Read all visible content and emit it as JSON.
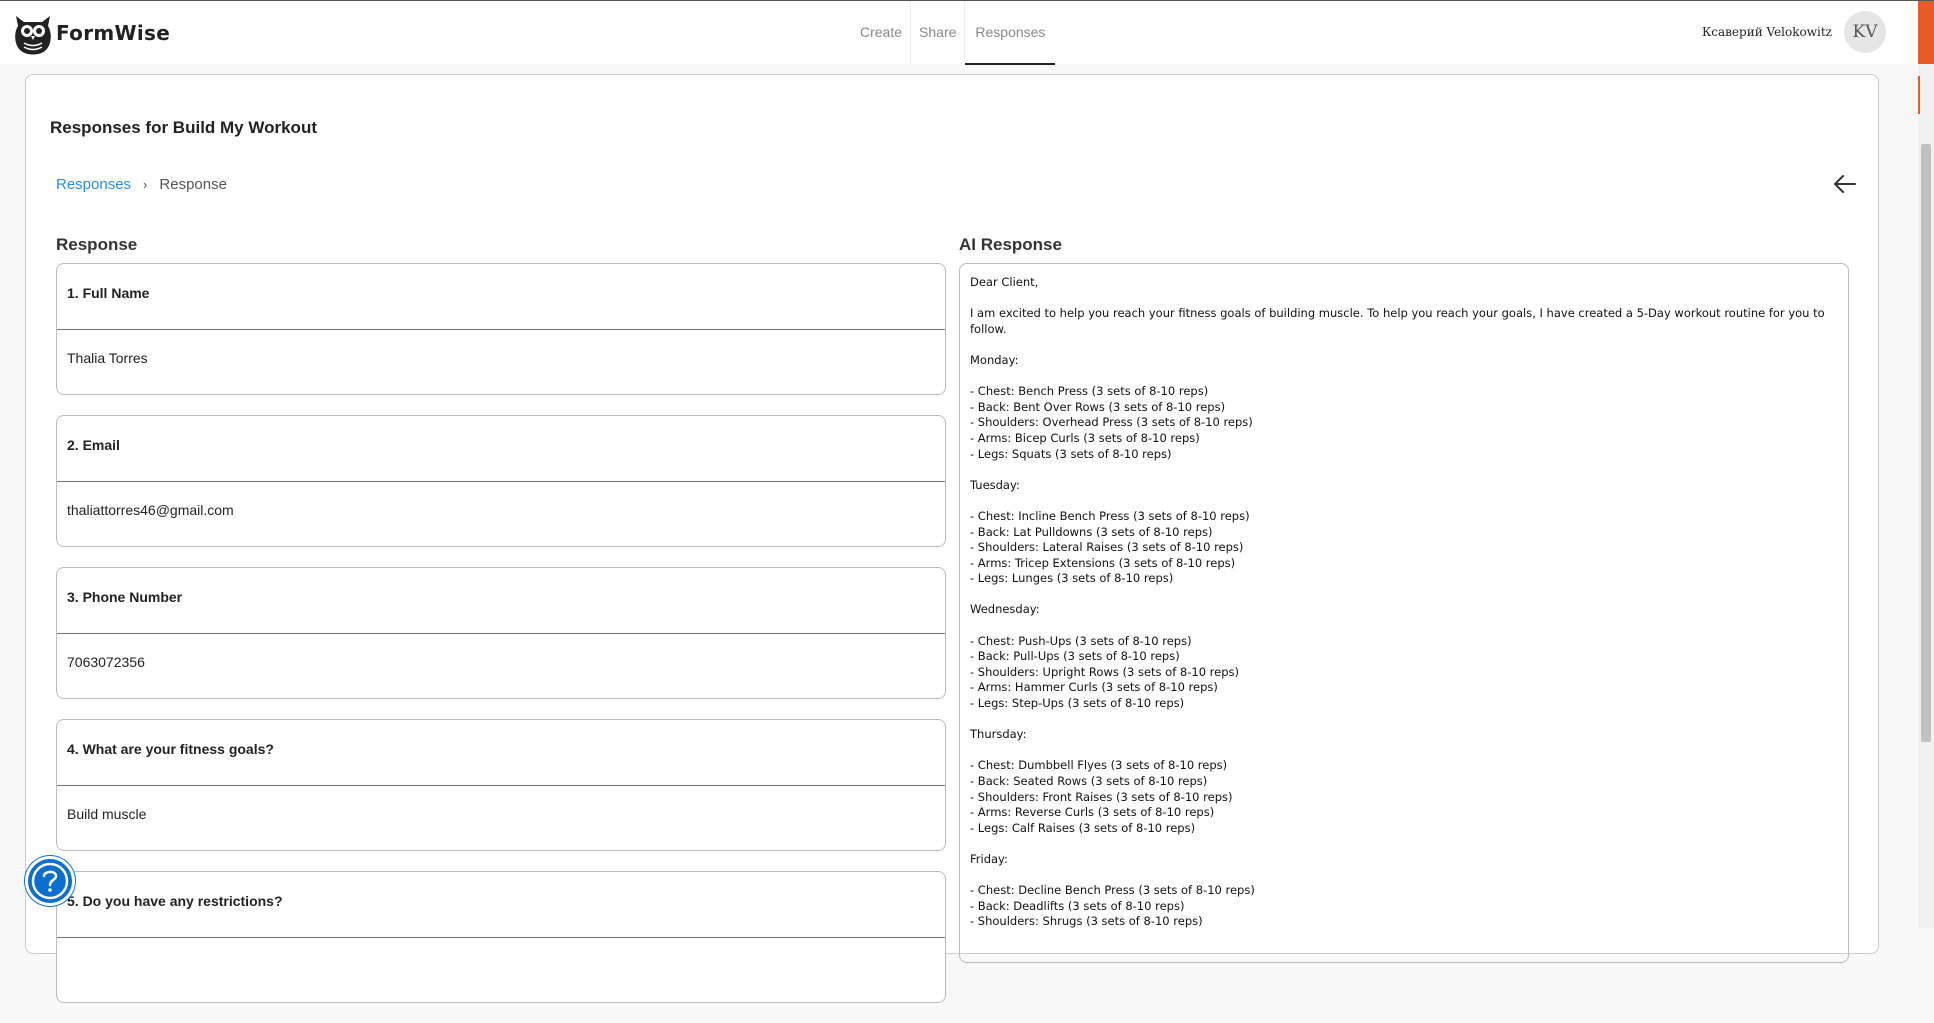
{
  "app": {
    "name": "FormWise"
  },
  "nav": {
    "items": [
      "Create",
      "Share",
      "Responses"
    ],
    "active": "Responses"
  },
  "user": {
    "name": "Ксаверий Velokowitz",
    "initials": "KV"
  },
  "page": {
    "title": "Responses for Build My Workout"
  },
  "breadcrumb": {
    "link": "Responses",
    "separator": "›",
    "current": "Response"
  },
  "response_section": {
    "title": "Response"
  },
  "questions": [
    {
      "question": "1. Full Name",
      "answer": "Thalia Torres"
    },
    {
      "question": "2. Email",
      "answer": "thaliattorres46@gmail.com"
    },
    {
      "question": "3. Phone Number",
      "answer": "7063072356"
    },
    {
      "question": "4. What are your fitness goals?",
      "answer": "Build muscle"
    },
    {
      "question": "5. Do you have any restrictions?",
      "answer": ""
    }
  ],
  "ai_section": {
    "title": "AI Response",
    "lines": [
      "Dear Client,",
      "",
      "I am excited to help you reach your fitness goals of building muscle. To help you reach your goals, I have created a 5-Day workout routine for you to follow.",
      "",
      "Monday:",
      "",
      "- Chest: Bench Press (3 sets of 8-10 reps)",
      "- Back: Bent Over Rows (3 sets of 8-10 reps)",
      "- Shoulders: Overhead Press (3 sets of 8-10 reps)",
      "- Arms: Bicep Curls (3 sets of 8-10 reps)",
      "- Legs: Squats (3 sets of 8-10 reps)",
      "",
      "Tuesday:",
      "",
      "- Chest: Incline Bench Press (3 sets of 8-10 reps)",
      "- Back: Lat Pulldowns (3 sets of 8-10 reps)",
      "- Shoulders: Lateral Raises (3 sets of 8-10 reps)",
      "- Arms: Tricep Extensions (3 sets of 8-10 reps)",
      "- Legs: Lunges (3 sets of 8-10 reps)",
      "",
      "Wednesday:",
      "",
      "- Chest: Push-Ups (3 sets of 8-10 reps)",
      "- Back: Pull-Ups (3 sets of 8-10 reps)",
      "- Shoulders: Upright Rows (3 sets of 8-10 reps)",
      "- Arms: Hammer Curls (3 sets of 8-10 reps)",
      "- Legs: Step-Ups (3 sets of 8-10 reps)",
      "",
      "Thursday:",
      "",
      "- Chest: Dumbbell Flyes (3 sets of 8-10 reps)",
      "- Back: Seated Rows (3 sets of 8-10 reps)",
      "- Shoulders: Front Raises (3 sets of 8-10 reps)",
      "- Arms: Reverse Curls (3 sets of 8-10 reps)",
      "- Legs: Calf Raises (3 sets of 8-10 reps)",
      "",
      "Friday:",
      "",
      "- Chest: Decline Bench Press (3 sets of 8-10 reps)",
      "- Back: Deadlifts (3 sets of 8-10 reps)",
      "- Shoulders: Shrugs (3 sets of 8-10 reps)"
    ]
  },
  "icons": {
    "logo": "owl-logo-icon",
    "back": "arrow-left-icon",
    "help": "question-mark-icon"
  },
  "colors": {
    "accent": "#e85a2a",
    "link": "#2f8fe0",
    "help_button": "#0a6fd1"
  }
}
